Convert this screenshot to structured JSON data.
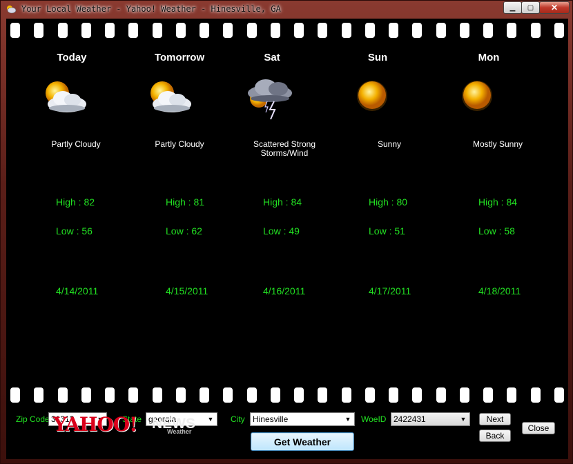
{
  "window": {
    "title": "Your Local Weather - Yahoo! Weather - Hinesville, GA",
    "minimize_icon": "minimize-icon",
    "maximize_icon": "maximize-icon",
    "close_icon": "close-icon"
  },
  "forecast": [
    {
      "day": "Today",
      "icon": "partly-cloudy-icon",
      "condition": "Partly Cloudy",
      "high": "High : 82",
      "low": "Low : 56",
      "date": "4/14/2011"
    },
    {
      "day": "Tomorrow",
      "icon": "partly-cloudy-icon",
      "condition": "Partly Cloudy",
      "high": "High : 81",
      "low": "Low : 62",
      "date": "4/15/2011"
    },
    {
      "day": "Sat",
      "icon": "thunderstorm-icon",
      "condition": "Scattered Strong Storms/Wind",
      "high": "High : 84",
      "low": "Low : 49",
      "date": "4/16/2011"
    },
    {
      "day": "Sun",
      "icon": "sun-icon",
      "condition": "Sunny",
      "high": "High : 80",
      "low": "Low : 51",
      "date": "4/17/2011"
    },
    {
      "day": "Mon",
      "icon": "sun-icon",
      "condition": "Mostly Sunny",
      "high": "High : 84",
      "low": "Low : 58",
      "date": "4/18/2011"
    }
  ],
  "controls": {
    "zip_label": "Zip Code",
    "zip_value": "31313",
    "state_label": "State",
    "state_value": "georgia",
    "city_label": "City",
    "city_value": "Hinesville",
    "woeid_label": "WoeID",
    "woeid_value": "2422431",
    "next_label": "Next",
    "back_label": "Back",
    "close_label": "Close",
    "get_weather_label": "Get Weather"
  },
  "logo": {
    "yahoo": "YAHOO!",
    "news": "NEWS",
    "weather": "Weather"
  },
  "colors": {
    "accent_green": "#22e022",
    "background": "#000000"
  }
}
